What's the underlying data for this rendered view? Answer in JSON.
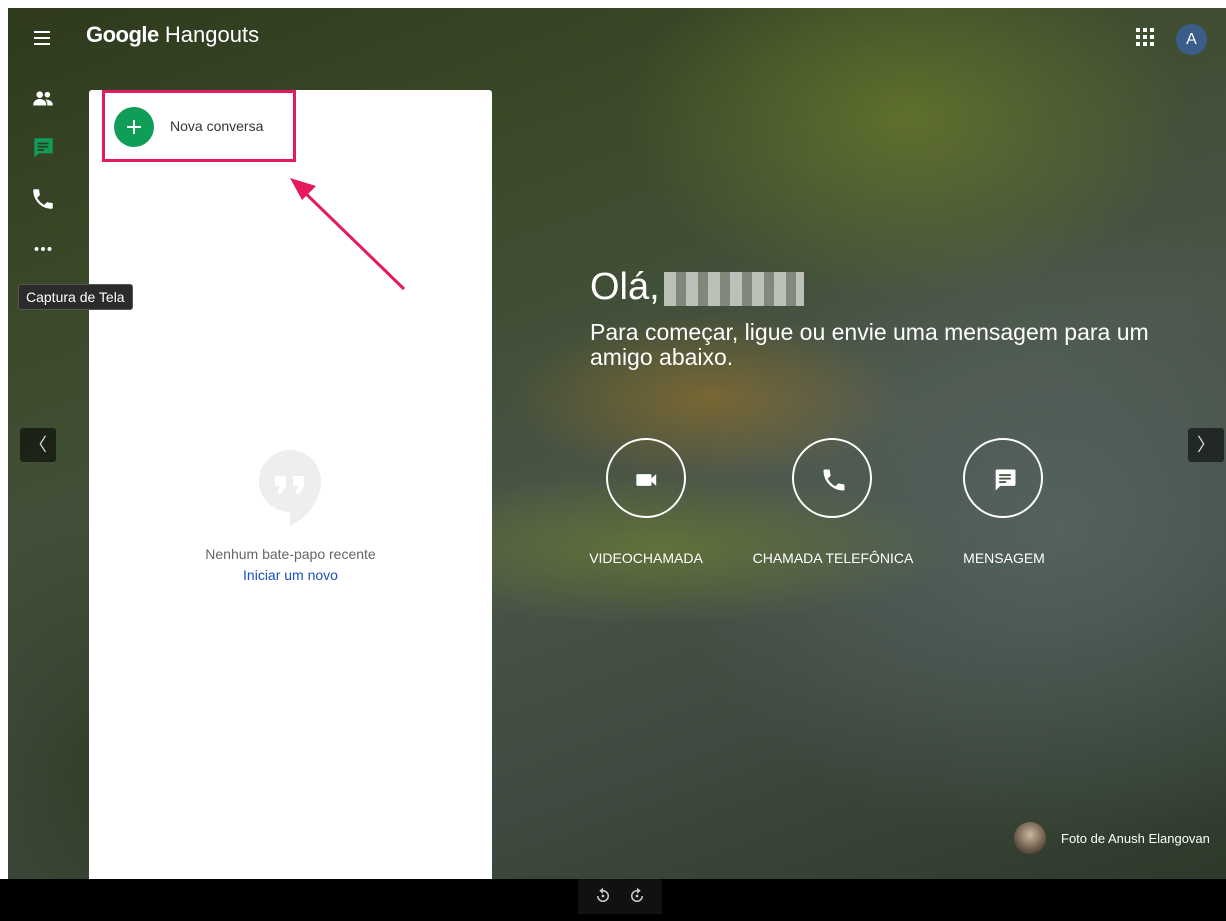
{
  "header": {
    "logo_google": "Google",
    "logo_product": "Hangouts",
    "avatar_letter": "A"
  },
  "sidebar": {
    "items": [
      {
        "name": "contacts",
        "icon": "people-icon",
        "active": false
      },
      {
        "name": "conversations",
        "icon": "chat-icon",
        "active": true
      },
      {
        "name": "calls",
        "icon": "phone-icon",
        "active": false
      },
      {
        "name": "more",
        "icon": "more-horiz-icon",
        "active": false
      }
    ],
    "tooltip": "Captura de Tela"
  },
  "panel": {
    "new_conversation_label": "Nova conversa",
    "empty_text": "Nenhum bate-papo recente",
    "start_link": "Iniciar um novo"
  },
  "main": {
    "greeting": "Olá,",
    "subtitle": "Para começar, ligue ou envie uma mensagem para um amigo abaixo.",
    "actions": [
      {
        "label": "VIDEOCHAMADA",
        "icon": "videocam-icon"
      },
      {
        "label": "CHAMADA TELEFÔNICA",
        "icon": "phone-icon"
      },
      {
        "label": "MENSAGEM",
        "icon": "message-icon"
      }
    ],
    "photo_credit": "Foto de Anush Elangovan"
  },
  "nav": {
    "prev": "〈",
    "next": "〉"
  },
  "colors": {
    "accent_green": "#0f9d58",
    "highlight_pink": "#e5195f",
    "link_blue": "#1a4fbd"
  }
}
